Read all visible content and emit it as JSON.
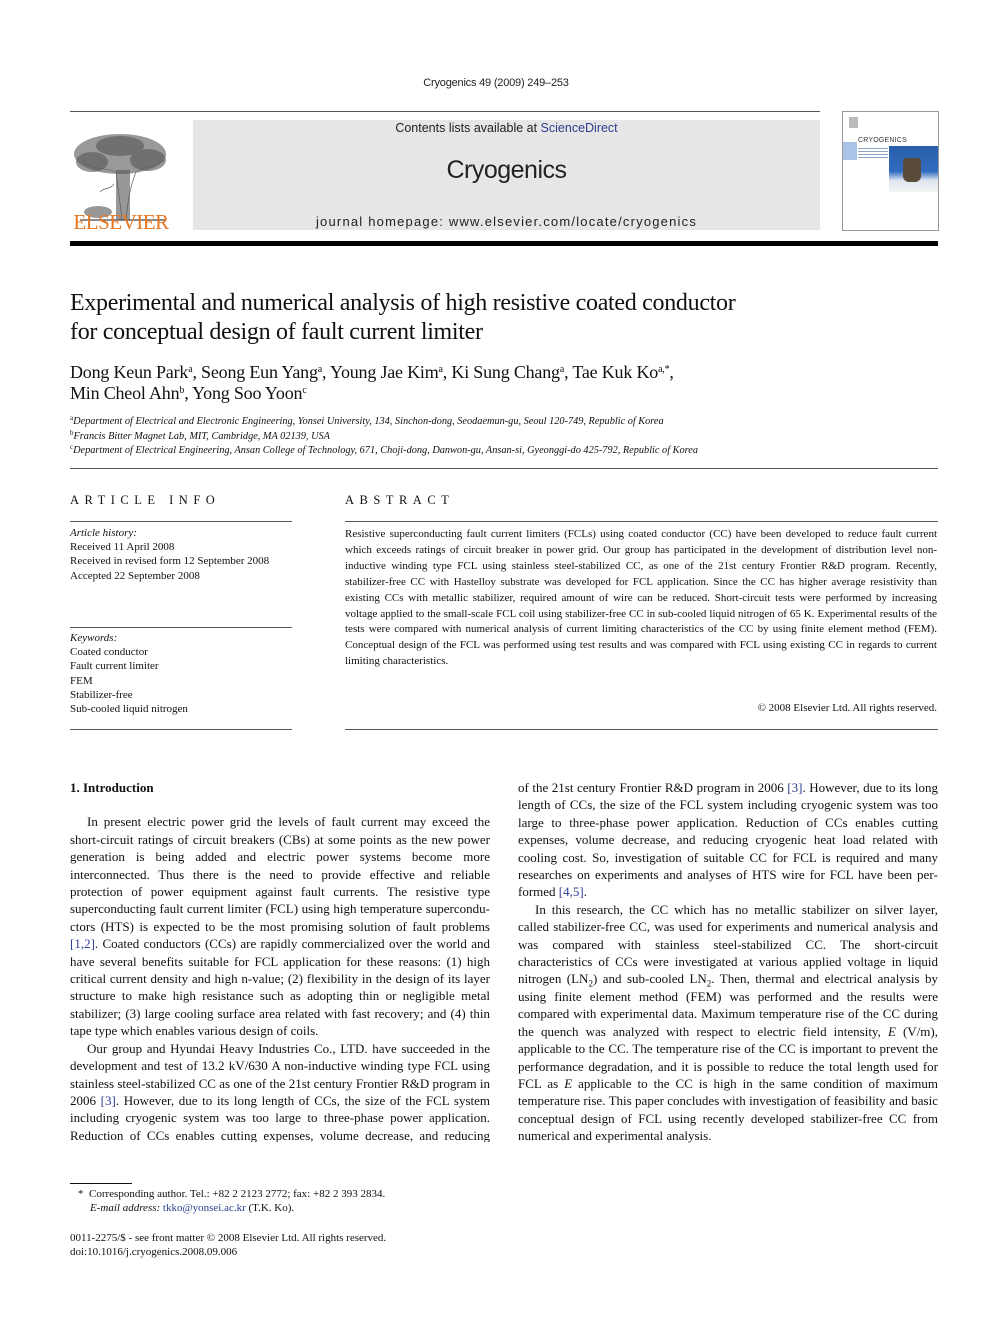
{
  "header": {
    "running_head": "Cryogenics 49 (2009) 249–253",
    "contents_prefix": "Contents lists available at ",
    "contents_link": "ScienceDirect",
    "journal_name": "Cryogenics",
    "homepage": "journal homepage: www.elsevier.com/locate/cryogenics",
    "publisher_logo_text": "ELSEVIER",
    "cover_title": "CRYOGENICS",
    "colors": {
      "brand_orange": "#e87722",
      "link_blue": "#2d3e8f",
      "banner_gray": "#e6e6e6"
    }
  },
  "article": {
    "title_line1": "Experimental and numerical analysis of high resistive coated conductor",
    "title_line2": "for conceptual design of fault current limiter",
    "authors": [
      {
        "name": "Dong Keun Park",
        "sup": "a",
        "sep": ", "
      },
      {
        "name": "Seong Eun Yang",
        "sup": "a",
        "sep": ", "
      },
      {
        "name": "Young Jae Kim",
        "sup": "a",
        "sep": ", "
      },
      {
        "name": "Ki Sung Chang",
        "sup": "a",
        "sep": ", "
      },
      {
        "name": "Tae Kuk Ko",
        "sup": "a,*",
        "sep": ","
      },
      {
        "name": "Min Cheol Ahn",
        "sup": "b",
        "sep": ", "
      },
      {
        "name": "Yong Soo Yoon",
        "sup": "c",
        "sep": ""
      }
    ],
    "affiliations": [
      {
        "mark": "a",
        "text": "Department of Electrical and Electronic Engineering, Yonsei University, 134, Sinchon-dong, Seodaemun-gu, Seoul 120-749, Republic of Korea"
      },
      {
        "mark": "b",
        "text": "Francis Bitter Magnet Lab, MIT, Cambridge, MA 02139, USA"
      },
      {
        "mark": "c",
        "text": "Department of Electrical Engineering, Ansan College of Technology, 671, Choji-dong, Danwon-gu, Ansan-si, Gyeonggi-do 425-792, Republic of Korea"
      }
    ]
  },
  "article_info": {
    "heading": "ARTICLE INFO",
    "history_label": "Article history:",
    "history": [
      "Received 11 April 2008",
      "Received in revised form 12 September 2008",
      "Accepted 22 September 2008"
    ],
    "keywords_label": "Keywords:",
    "keywords": [
      "Coated conductor",
      "Fault current limiter",
      "FEM",
      "Stabilizer-free",
      "Sub-cooled liquid nitrogen"
    ]
  },
  "abstract": {
    "heading": "ABSTRACT",
    "text": "Resistive superconducting fault current limiters (FCLs) using coated conductor (CC) have been developed to reduce fault current which exceeds ratings of circuit breaker in power grid. Our group has participated in the development of distribution level non-inductive winding type FCL using stainless steel-stabilized CC, as one of the 21st century Frontier R&D program. Recently, stabilizer-free CC with Hastelloy substrate was developed for FCL application. Since the CC has higher average resistivity than existing CCs with metallic stabilizer, required amount of wire can be reduced. Short-circuit tests were performed by increasing voltage applied to the small-scale FCL coil using stabilizer-free CC in sub-cooled liquid nitro­gen of 65 K. Experimental results of the tests were compared with numerical analysis of current limiting characteristics of the CC by using finite element method (FEM). Conceptual design of the FCL was per­formed using test results and was compared with FCL using existing CC in regards to current limiting characteristics.",
    "copyright": "© 2008 Elsevier Ltd. All rights reserved."
  },
  "body": {
    "section_heading": "1. Introduction",
    "p1_a": "In present electric power grid the levels of fault current may exceed the short-circuit ratings of circuit breakers (CBs) at some points as the new power generation is being added and electric power systems become more interconnected. Thus there is the need to provide effective and reliable protection of power equip­ment against fault currents. The resistive type superconducting fault current limiter (FCL) using high temperature supercondu­ctors (HTS) is expected to be the most promising solution of fault problems ",
    "p1_ref": "[1,2]",
    "p1_b": ". Coated conductors (CCs) are rapidly commercial­ized over the world and have several benefits suitable for FCL application for these reasons: (1) high critical current density and high n-value; (2) flexibility in the design of its layer struc­ture to make high resistance such as adopting thin or negligible metal stabilizer; (3) large cooling surface area related with fast recovery; and (4) thin tape type which enables various design of coils.",
    "p2_a": "Our group and Hyundai Heavy Industries Co., LTD. have suc­ceeded in the development and test of 13.2 kV/630 A non-induc­tive winding type FCL using stainless steel-stabilized CC as one of the 21st century Frontier R&D program in 2006 ",
    "p2_ref1": "[3]",
    "p2_b": ". However, due to its long length of CCs, the size of the FCL system including cryogenic system was too large to three-phase power application. Reduction of CCs enables cutting expenses, volume decrease, and reducing cryogenic heat load related with cooling cost. So, investi­gation of suitable CC for FCL is required and many researches on experiments and analyses of HTS wire for FCL have been per­formed ",
    "p2_ref2": "[4,5]",
    "p2_c": ".",
    "p3_a": "In this research, the CC which has no metallic stabilizer on sil­ver layer, called stabilizer-free CC, was used for experiments and numerical analysis and was compared with stainless steel-stabi­lized CC. The short-circuit characteristics of CCs were investi­gated at various applied voltage in liquid nitrogen (LN",
    "p3_sub1": "2",
    "p3_b": ") and sub-cooled LN",
    "p3_sub2": "2",
    "p3_c": ". Then, thermal and electrical analysis by using fi­nite element method (FEM) was performed and the results were compared with experimental data. Maximum temperature rise of the CC during the quench was analyzed with respect to electric field intensity, ",
    "p3_E1": "E",
    "p3_d": " (V/m), applicable to the CC. The temperature rise of the CC is important to prevent the performance degradation, and it is possible to reduce the total length used for FCL as ",
    "p3_E2": "E",
    "p3_e": " applicable to the CC is high in the same condition of maximum temperature rise. This paper concludes with investigation of feasibility and basic conceptual design of FCL using recently developed stabilizer-free CC from numerical and experimental analysis."
  },
  "footnote": {
    "star": "*",
    "corresponding": "Corresponding author. Tel.: +82 2 2123 2772; fax: +82 2 393 2834.",
    "email_label": "E-mail address:",
    "email": "tkko@yonsei.ac.kr",
    "email_suffix": " (T.K. Ko)."
  },
  "front_matter": {
    "issn_line": "0011-2275/$ - see front matter © 2008 Elsevier Ltd. All rights reserved.",
    "doi": "doi:10.1016/j.cryogenics.2008.09.006"
  }
}
